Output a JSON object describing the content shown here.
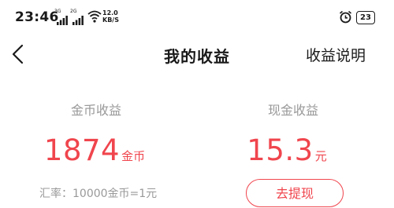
{
  "status_bar": {
    "time": "23:46",
    "signal1_label": "3G",
    "signal2_label": "2G",
    "speed_value": "12.0",
    "speed_unit": "KB/S",
    "battery": "23",
    "icons": [
      "wifi-icon",
      "alarm-icon",
      "battery-icon"
    ]
  },
  "header": {
    "title": "我的收益",
    "help_label": "收益说明",
    "back_icon": "chevron-left-icon"
  },
  "earnings": {
    "coins": {
      "title": "金币收益",
      "amount": "1874",
      "unit": "金币"
    },
    "cash": {
      "title": "现金收益",
      "amount": "15.3",
      "unit": "元"
    }
  },
  "exchange_rate": "汇率：10000金币=1元",
  "withdraw_label": "去提现",
  "colors": {
    "accent": "#f0454d",
    "muted": "#999999",
    "text": "#1a1a1a"
  }
}
